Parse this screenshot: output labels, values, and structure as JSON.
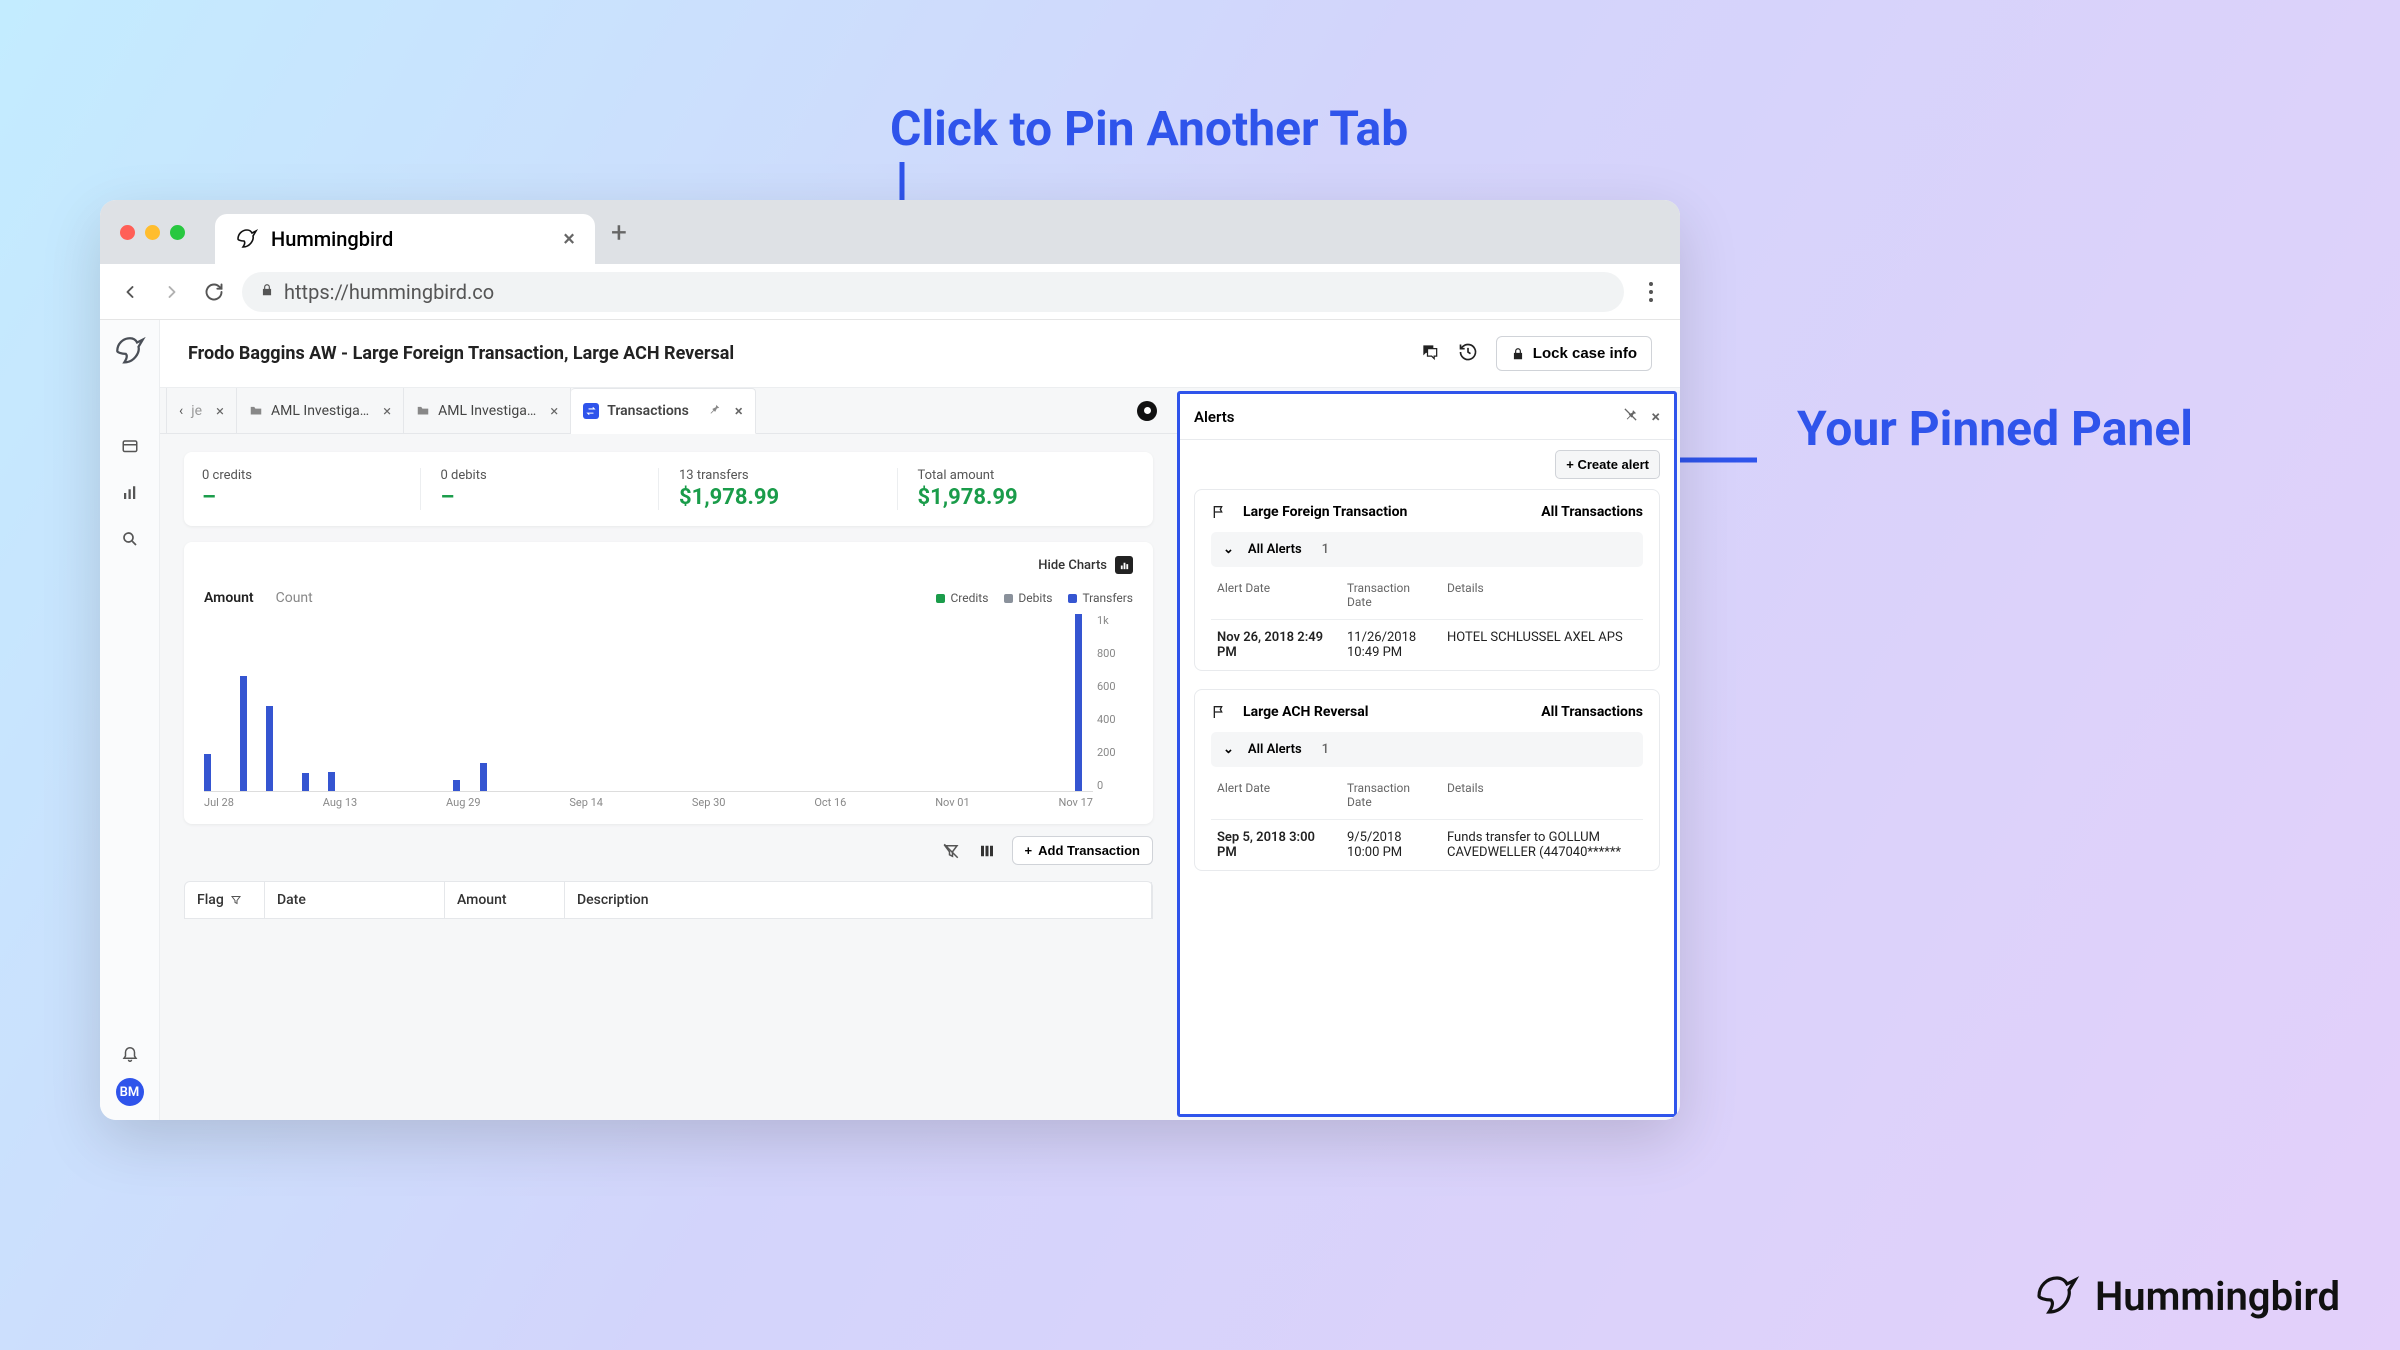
{
  "annotations": {
    "pin_tab": "Click to Pin Another Tab",
    "pinned_panel": "Your Pinned Panel"
  },
  "brand": "Hummingbird",
  "browser": {
    "tab_title": "Hummingbird",
    "url": "https://hummingbird.co"
  },
  "case": {
    "title": "Frodo Baggins AW - Large Foreign Transaction, Large ACH Reversal",
    "lock_label": "Lock case info"
  },
  "sidebar": {
    "avatar": "BM"
  },
  "tabs": [
    {
      "label": "je"
    },
    {
      "label": "AML Investiga…"
    },
    {
      "label": "AML Investiga…"
    },
    {
      "label": "Transactions"
    }
  ],
  "summary": [
    {
      "label": "0 credits",
      "value": "–"
    },
    {
      "label": "0 debits",
      "value": "–"
    },
    {
      "label": "13 transfers",
      "value": "$1,978.99"
    },
    {
      "label": "Total amount",
      "value": "$1,978.99"
    }
  ],
  "chart": {
    "hide": "Hide Charts",
    "tab1": "Amount",
    "tab2": "Count",
    "legend": {
      "credits": "Credits",
      "debits": "Debits",
      "transfers": "Transfers"
    },
    "ylabels": [
      "1k",
      "800",
      "600",
      "400",
      "200",
      "0"
    ],
    "xlabels": [
      "Jul 28",
      "Aug 13",
      "Aug 29",
      "Sep 14",
      "Sep 30",
      "Oct 16",
      "Nov 01",
      "Nov 17"
    ]
  },
  "chart_data": {
    "type": "bar",
    "series_name": "Transfers",
    "x": [
      "Jul 28",
      "Aug 02",
      "Aug 05",
      "Aug 09",
      "Aug 13",
      "Aug 29",
      "Sep 01",
      "Nov 20"
    ],
    "values": [
      210,
      650,
      480,
      100,
      110,
      60,
      160,
      1000
    ],
    "ylim": [
      0,
      1000
    ],
    "x_range": [
      "Jul 28",
      "Nov 17"
    ],
    "ylabel": "",
    "xlabel": ""
  },
  "tx_toolbar": {
    "add": "Add Transaction"
  },
  "table": {
    "flag": "Flag",
    "date": "Date",
    "amount": "Amount",
    "desc": "Description"
  },
  "alerts": {
    "title": "Alerts",
    "create": "+ Create alert",
    "all_alerts": "All Alerts",
    "all_tx": "All Transactions",
    "headers": {
      "alert_date": "Alert Date",
      "tx_date": "Transaction Date",
      "details": "Details"
    },
    "cards": [
      {
        "name": "Large Foreign Transaction",
        "count": "1",
        "row": {
          "alert_date": "Nov 26, 2018 2:49 PM",
          "tx_date": "11/26/2018 10:49 PM",
          "details": "HOTEL SCHLUSSEL AXEL APS"
        }
      },
      {
        "name": "Large ACH Reversal",
        "count": "1",
        "row": {
          "alert_date": "Sep 5, 2018 3:00 PM",
          "tx_date": "9/5/2018 10:00 PM",
          "details": "Funds transfer to GOLLUM CAVEDWELLER (447040******"
        }
      }
    ]
  }
}
